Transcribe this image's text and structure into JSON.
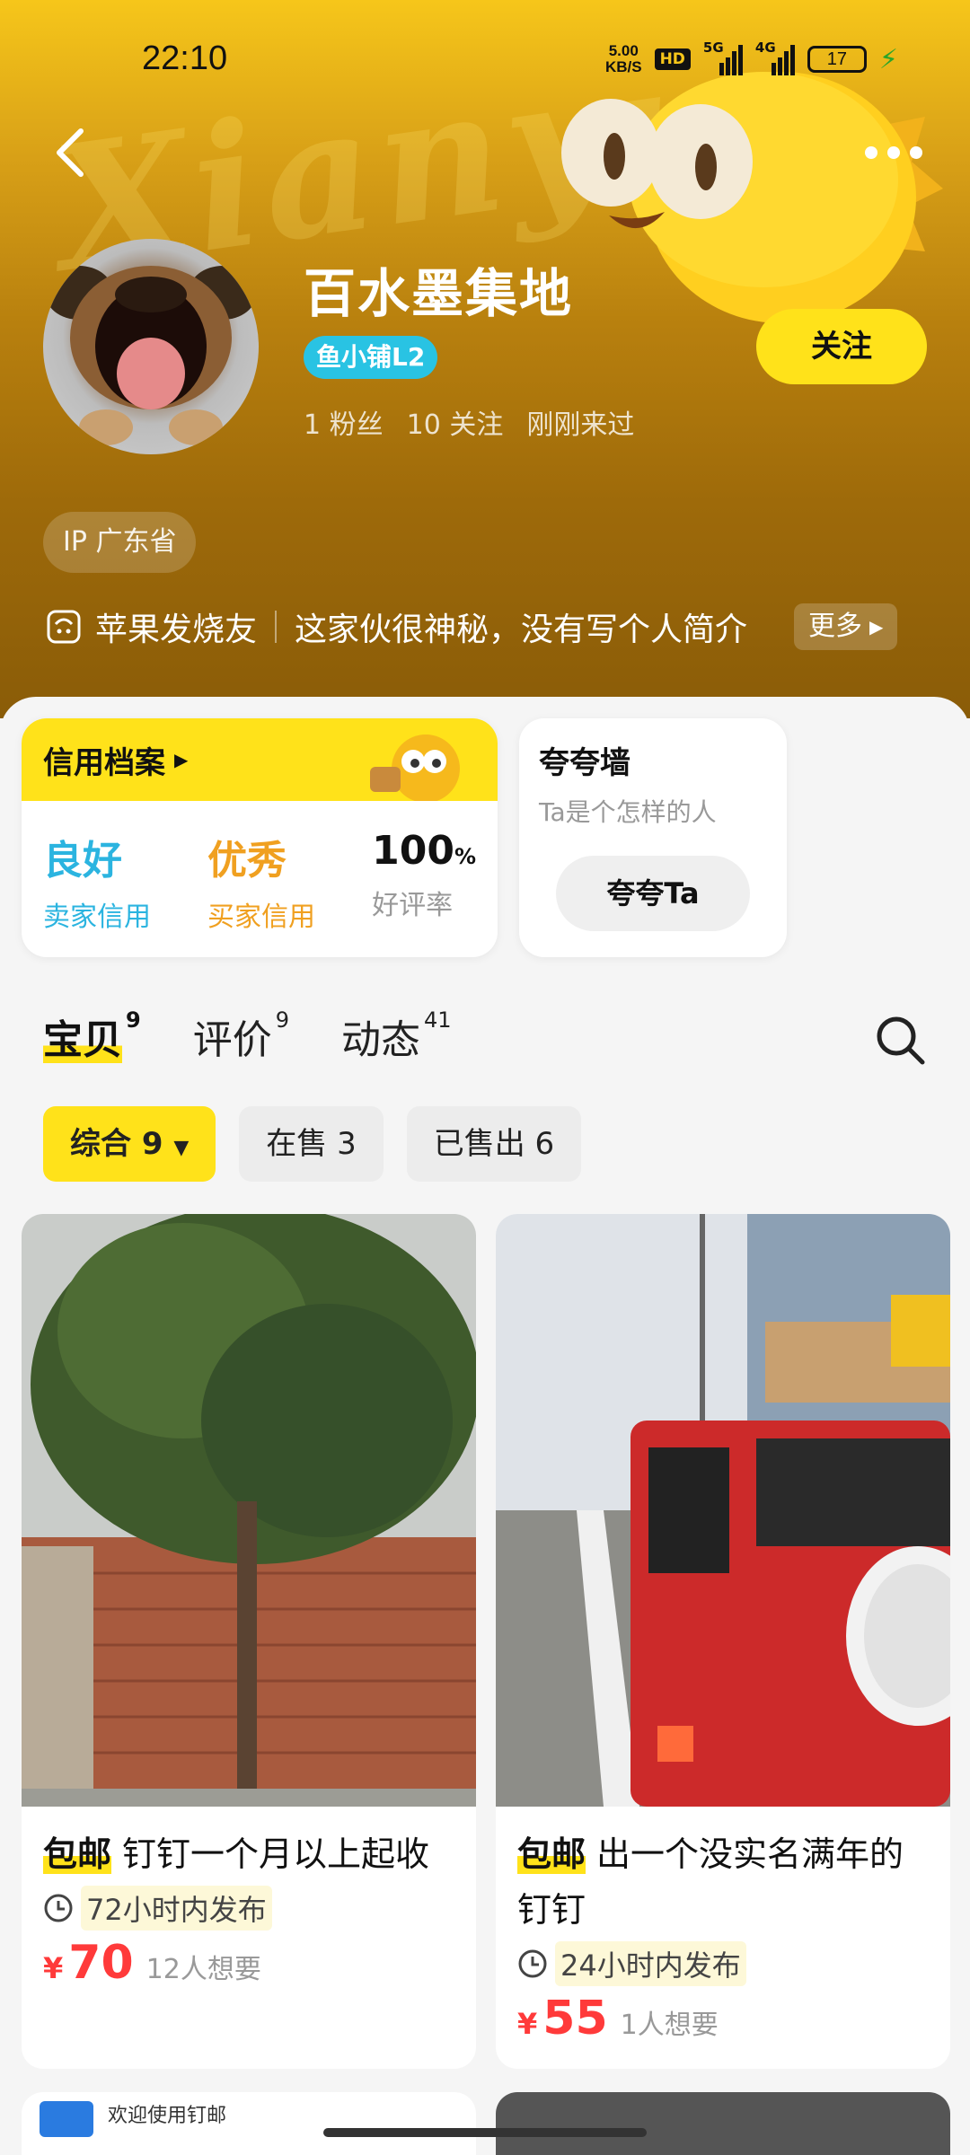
{
  "status_bar": {
    "time": "22:10",
    "speed_value": "5.00",
    "speed_unit": "KB/S",
    "hd": "HD",
    "net1": "5G",
    "net2": "4G",
    "battery": "17"
  },
  "profile": {
    "name": "百水墨集地",
    "level_badge": "鱼小铺L2",
    "fans": "1 粉丝",
    "following": "10 关注",
    "last_seen": "刚刚来过",
    "follow_label": "关注",
    "ip": "IP 广东省",
    "tag": "苹果发烧友",
    "bio": "这家伙很神秘，没有写个人简介",
    "more_label": "更多"
  },
  "credit": {
    "title": "信用档案",
    "seller_rating": "良好",
    "seller_label": "卖家信用",
    "buyer_rating": "优秀",
    "buyer_label": "买家信用",
    "good_rate": "100",
    "good_rate_unit": "%",
    "good_rate_label": "好评率"
  },
  "praise": {
    "title": "夸夸墙",
    "subtitle": "Ta是个怎样的人",
    "button": "夸夸Ta"
  },
  "tabs": [
    {
      "label": "宝贝",
      "count": "9"
    },
    {
      "label": "评价",
      "count": "9"
    },
    {
      "label": "动态",
      "count": "41"
    }
  ],
  "filters": [
    {
      "label": "综合 9"
    },
    {
      "label": "在售 3"
    },
    {
      "label": "已售出 6"
    }
  ],
  "items": [
    {
      "free_shipping": "包邮",
      "title": "钉钉一个月以上起收",
      "posted": "72小时内发布",
      "currency": "¥",
      "price": "70",
      "wants": "12人想要"
    },
    {
      "free_shipping": "包邮",
      "title": "出一个没实名满年的钉钉",
      "posted": "24小时内发布",
      "currency": "¥",
      "price": "55",
      "wants": "1人想要"
    }
  ],
  "peek_text": "欢迎使用钉邮",
  "colors": {
    "accent": "#ffe21a",
    "price": "#ff3a3a",
    "seller_credit": "#2bb4e0",
    "buyer_credit": "#f0a020",
    "level_badge": "#29c3e3"
  }
}
